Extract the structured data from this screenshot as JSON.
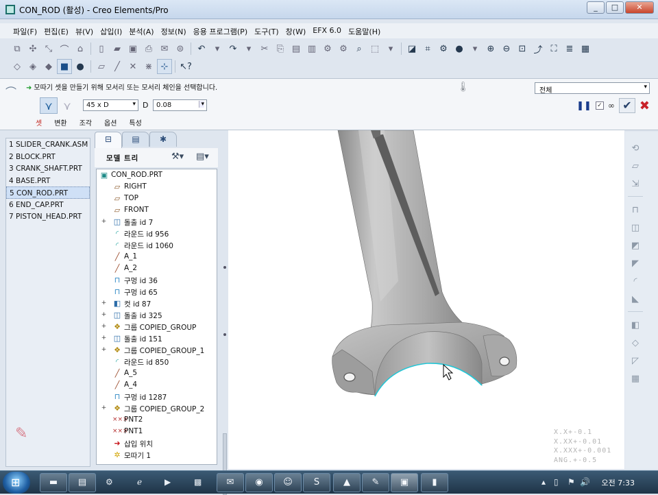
{
  "window": {
    "title": "CON_ROD (활성) - Creo Elements/Pro",
    "buttons": [
      "_",
      "□",
      "✕"
    ]
  },
  "menu": [
    "파일(F)",
    "편집(E)",
    "뷰(V)",
    "삽입(I)",
    "분석(A)",
    "정보(N)",
    "응용 프로그램(P)",
    "도구(T)",
    "창(W)",
    "EFX 6.0",
    "도움말(H)"
  ],
  "dashboard": {
    "prompt": "모따기 셋을 만들기 위해 모서리 또는 모서리 체인을 선택합니다.",
    "filter": "전체",
    "scheme": "45 x D",
    "d_label": "D",
    "d_value": "0.08",
    "tabs": [
      "셋",
      "변환",
      "조각",
      "옵션",
      "특성"
    ]
  },
  "windows": [
    "1 SLIDER_CRANK.ASM",
    "2 BLOCK.PRT",
    "3 CRANK_SHAFT.PRT",
    "4 BASE.PRT",
    "5 CON_ROD.PRT",
    "6 END_CAP.PRT",
    "7 PISTON_HEAD.PRT"
  ],
  "selected_window_index": 4,
  "navigator": {
    "header": "모델 트리"
  },
  "tree": {
    "root": "CON_ROD.PRT",
    "items": [
      {
        "label": "RIGHT",
        "icon": "datum-plane-icon",
        "expand": false
      },
      {
        "label": "TOP",
        "icon": "datum-plane-icon",
        "expand": false
      },
      {
        "label": "FRONT",
        "icon": "datum-plane-icon",
        "expand": false
      },
      {
        "label": "돌출 id 7",
        "icon": "extrude-icon",
        "expand": true
      },
      {
        "label": "라운드 id 956",
        "icon": "round-icon",
        "expand": false
      },
      {
        "label": "라운드 id 1060",
        "icon": "round-icon",
        "expand": false
      },
      {
        "label": "A_1",
        "icon": "axis-icon",
        "expand": false
      },
      {
        "label": "A_2",
        "icon": "axis-icon",
        "expand": false
      },
      {
        "label": "구멍 id 36",
        "icon": "hole-icon",
        "expand": false
      },
      {
        "label": "구멍 id 65",
        "icon": "hole-icon",
        "expand": false
      },
      {
        "label": "컷 id 87",
        "icon": "cut-icon",
        "expand": true
      },
      {
        "label": "돌출 id 325",
        "icon": "extrude-icon",
        "expand": true
      },
      {
        "label": "그룹 COPIED_GROUP",
        "icon": "group-icon",
        "expand": true
      },
      {
        "label": "돌출 id 151",
        "icon": "extrude-icon",
        "expand": true
      },
      {
        "label": "그룹 COPIED_GROUP_1",
        "icon": "group-icon",
        "expand": true
      },
      {
        "label": "라운드 id 850",
        "icon": "round-icon",
        "expand": false
      },
      {
        "label": "A_5",
        "icon": "axis-icon",
        "expand": false
      },
      {
        "label": "A_4",
        "icon": "axis-icon",
        "expand": false
      },
      {
        "label": "구멍 id 1287",
        "icon": "hole-icon",
        "expand": false
      },
      {
        "label": "그룹 COPIED_GROUP_2",
        "icon": "group-icon",
        "expand": true
      },
      {
        "label": "PNT2",
        "icon": "datum-point-icon",
        "expand": false
      },
      {
        "label": "PNT1",
        "icon": "datum-point-icon",
        "expand": false
      },
      {
        "label": "삽입 위치",
        "icon": "insert-here-icon",
        "expand": false
      },
      {
        "label": "모따기 1",
        "icon": "chamfer-icon",
        "expand": false
      }
    ]
  },
  "tolerance": [
    "X.X+-0.1",
    "X.XX+-0.01",
    "X.XXX+-0.001",
    "ANG.+-0.5"
  ],
  "taskbar": {
    "clock": "오전 7:33"
  },
  "colors": {
    "accent": "#2b6ca8",
    "cancel": "#c8222a",
    "ok_green": "#1b9a28",
    "selected_edge": "#23c6d6"
  }
}
